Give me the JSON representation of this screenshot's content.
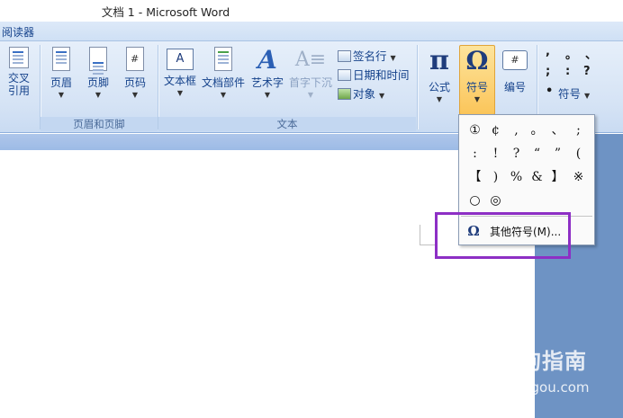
{
  "window": {
    "title": "文档 1 - Microsoft Word"
  },
  "tabs": {
    "active_label": "阅读器"
  },
  "ribbon": {
    "left_group": {
      "cross_ref_l1": "交叉",
      "cross_ref_l2": "引用"
    },
    "header_footer_group": {
      "label": "页眉和页脚",
      "header": "页眉",
      "footer": "页脚",
      "page_number": "页码"
    },
    "text_group": {
      "label": "文本",
      "textbox": "文本框",
      "quick_parts": "文档部件",
      "wordart": "艺术字",
      "dropcap": "首字下沉",
      "signature_line": "签名行",
      "date_time": "日期和时间",
      "object": "对象"
    },
    "symbols_group": {
      "equation": "公式",
      "symbol": "符号",
      "number": "编号",
      "special_symbol": "符号"
    },
    "special_punct": [
      ",",
      "。",
      "、",
      ";",
      ":",
      "?",
      "•"
    ]
  },
  "symbol_dropdown": {
    "symbols": [
      "①",
      "¢",
      ",",
      "。",
      "、",
      ";",
      ":",
      "!",
      "?",
      "“",
      "”",
      "(",
      "【",
      ")",
      "%",
      "&",
      "】",
      "※",
      "○",
      "◎"
    ],
    "more_symbols_label": "其他符号(M)...",
    "more_symbols_icon": "omega-icon"
  },
  "watermark": {
    "text": "搜狗指南",
    "url": "zhinan.sogou.com"
  },
  "colors": {
    "highlight": "#8d2fc5",
    "active_button": "#fbc55a",
    "ribbon_text": "#15428b"
  }
}
